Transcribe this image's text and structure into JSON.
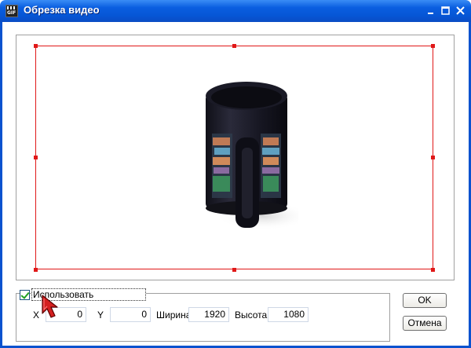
{
  "window": {
    "title": "Обрезка видео",
    "app_icon_text": "GIF",
    "controls": [
      "minimize",
      "maximize",
      "close"
    ]
  },
  "crop": {
    "use_label": "Использовать",
    "use_checked": true,
    "x_label": "X",
    "x_value": "0",
    "y_label": "Y",
    "y_value": "0",
    "width_label": "Ширина",
    "width_value": "1920",
    "height_label": "Высота",
    "height_value": "1080"
  },
  "buttons": {
    "ok_label": "OK",
    "cancel_label": "Отмена"
  },
  "colors": {
    "title_bar": "#0656d6",
    "crop_rect": "#e01818",
    "checkmark": "#21a121",
    "cursor": "#d42020"
  },
  "icons": {
    "app": "clapperboard-gif-icon",
    "minimize": "minimize-icon",
    "maximize": "maximize-icon",
    "close": "close-icon",
    "cursor": "mouse-pointer-icon"
  }
}
